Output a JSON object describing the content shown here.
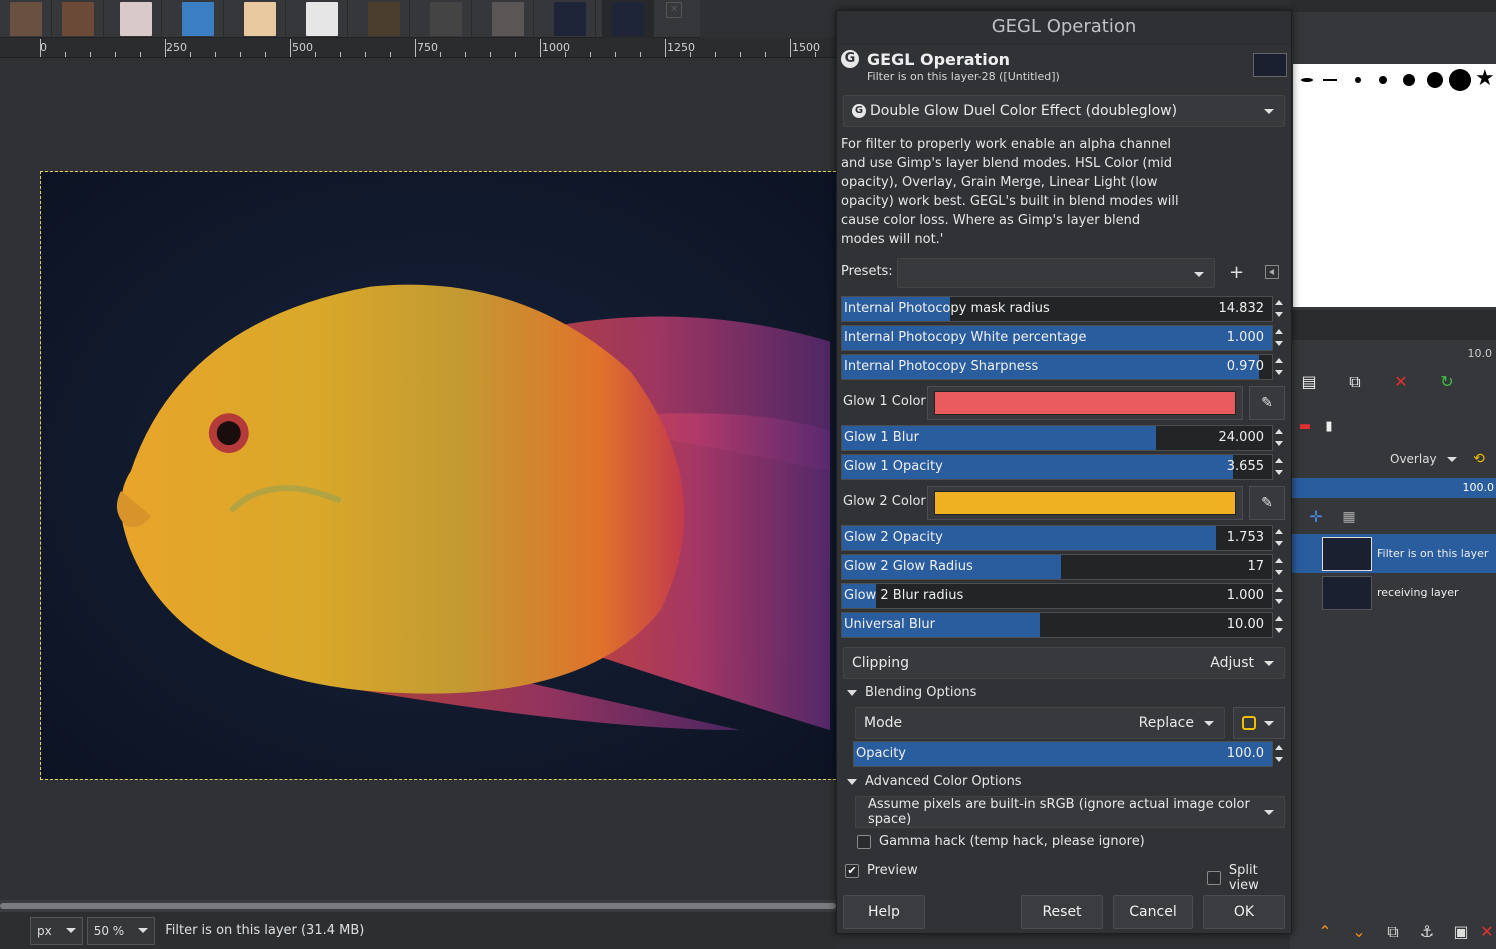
{
  "dialog": {
    "window_title": "GEGL Operation",
    "header_title": "GEGL Operation",
    "header_subtitle": "Filter is on this layer-28 ([Untitled])",
    "operation": "Double Glow Duel Color Effect (doubleglow)",
    "description": "For filter to properly work enable an alpha channel and use Gimp's layer blend modes. HSL Color (mid opacity),  Overlay, Grain Merge, Linear Light (low opacity) work best. GEGL's built in blend modes will cause color loss. Where as Gimp's layer blend modes will not.'",
    "presets_label": "Presets:",
    "sliders": [
      {
        "label": "Internal Photocopy mask radius",
        "value": "14.832",
        "fill": 0.25
      },
      {
        "label": "Internal Photocopy White percentage",
        "value": "1.000",
        "fill": 1.0
      },
      {
        "label": "Internal Photocopy Sharpness",
        "value": "0.970",
        "fill": 0.97
      }
    ],
    "glow1": {
      "label": "Glow 1 Color",
      "color": "#ea5b5e"
    },
    "glow1_sliders": [
      {
        "label": "Glow 1 Blur",
        "value": "24.000",
        "fill": 0.73
      },
      {
        "label": "Glow 1 Opacity",
        "value": "3.655",
        "fill": 0.91
      }
    ],
    "glow2": {
      "label": "Glow 2 Color",
      "color": "#efb021"
    },
    "glow2_sliders": [
      {
        "label": "Glow 2 Opacity",
        "value": "1.753",
        "fill": 0.87
      },
      {
        "label": "Glow 2 Glow Radius",
        "value": "17",
        "fill": 0.51
      },
      {
        "label": "Glow 2 Blur radius",
        "value": "1.000",
        "fill": 0.08
      },
      {
        "label": "Universal Blur",
        "value": "10.00",
        "fill": 0.46
      }
    ],
    "clipping": {
      "label": "Clipping",
      "value": "Adjust"
    },
    "blending": {
      "title": "Blending Options",
      "mode_label": "Mode",
      "mode_value": "Replace",
      "opacity_label": "Opacity",
      "opacity_value": "100.0",
      "opacity_fill": 1.0
    },
    "advanced": {
      "title": "Advanced Color Options",
      "colorspace": "Assume pixels are built-in sRGB (ignore actual image color space)",
      "gamma_hack": "Gamma hack (temp hack, please ignore)"
    },
    "preview_label": "Preview",
    "preview_checked": true,
    "split_view_label": "Split view",
    "buttons": {
      "help": "Help",
      "reset": "Reset",
      "cancel": "Cancel",
      "ok": "OK"
    }
  },
  "ruler": {
    "labels": [
      "0",
      "250",
      "500",
      "750",
      "1000",
      "1250",
      "1500"
    ]
  },
  "statusbar": {
    "unit": "px",
    "zoom": "50 %",
    "text": "Filter is on this layer (31.4 MB)"
  },
  "right_dock": {
    "brush_size_value": "10.0",
    "layer_mode": "Overlay",
    "layer_opacity": "100.0",
    "layers": [
      {
        "name": "Filter is on this layer",
        "selected": true
      },
      {
        "name": "receiving layer",
        "selected": false
      }
    ]
  },
  "colors": {
    "accent": "#2a5d9e",
    "selection_outline": "#e5d45a"
  }
}
